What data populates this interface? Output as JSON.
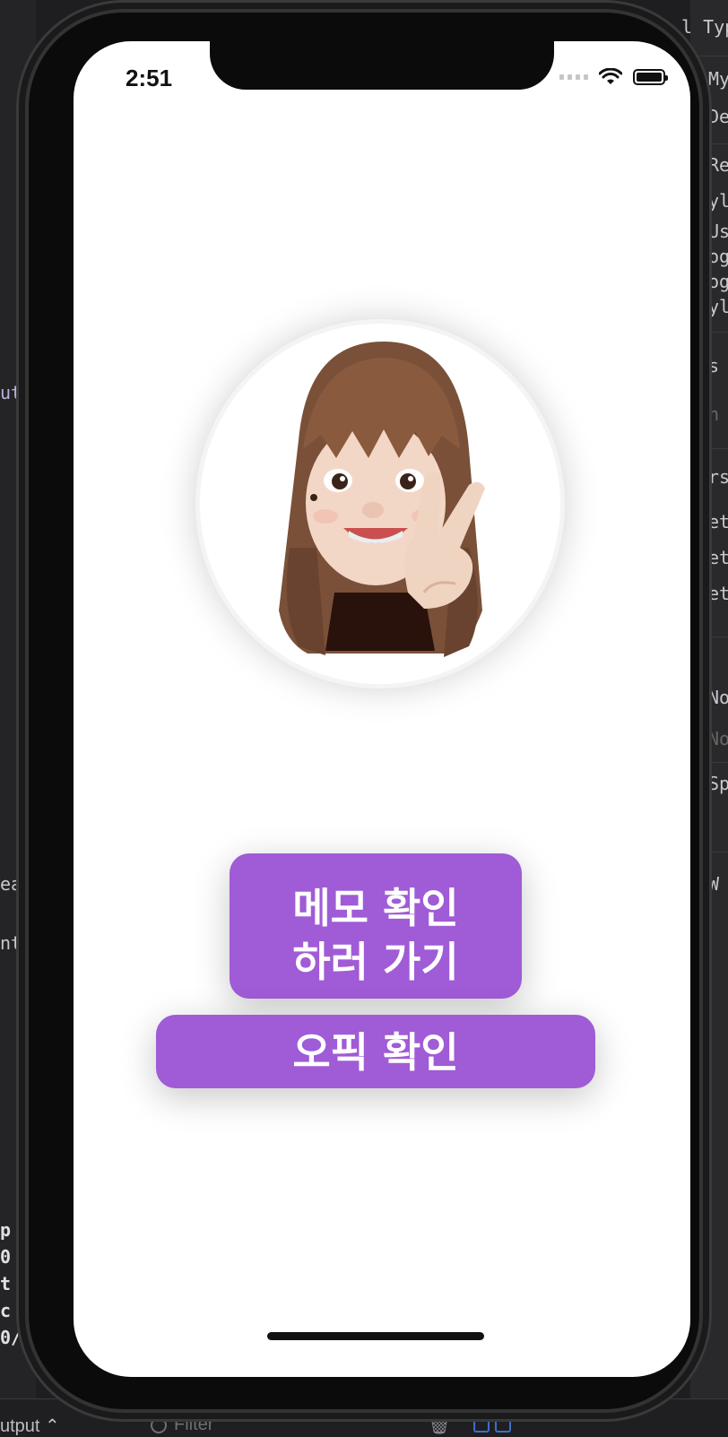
{
  "status_bar": {
    "time": "2:51"
  },
  "buttons": {
    "memo_line1": "메모 확인",
    "memo_line2": "하러 가기",
    "opic": "오픽 확인"
  },
  "background": {
    "right_fragments": [
      "l Typ",
      "My",
      "De",
      "Re",
      "yl",
      "Us",
      "og",
      "og",
      "yl",
      "s",
      "n",
      "rs",
      "et",
      "et",
      "et",
      "No",
      "No",
      "Sp",
      "W"
    ],
    "left_fragments": [
      "ut",
      "ea",
      "nt",
      "p",
      "0",
      "t",
      "c",
      "0/"
    ],
    "output_label": "utput ⌃",
    "filter_placeholder": "Filter"
  },
  "colors": {
    "button_purple": "#a05bd6",
    "screen_bg": "#ffffff",
    "device_frame": "#0b0b0c"
  },
  "icons": [
    "wifi-icon",
    "battery-icon",
    "signal-icon",
    "filter-icon",
    "trash-icon",
    "memoji-avatar"
  ]
}
